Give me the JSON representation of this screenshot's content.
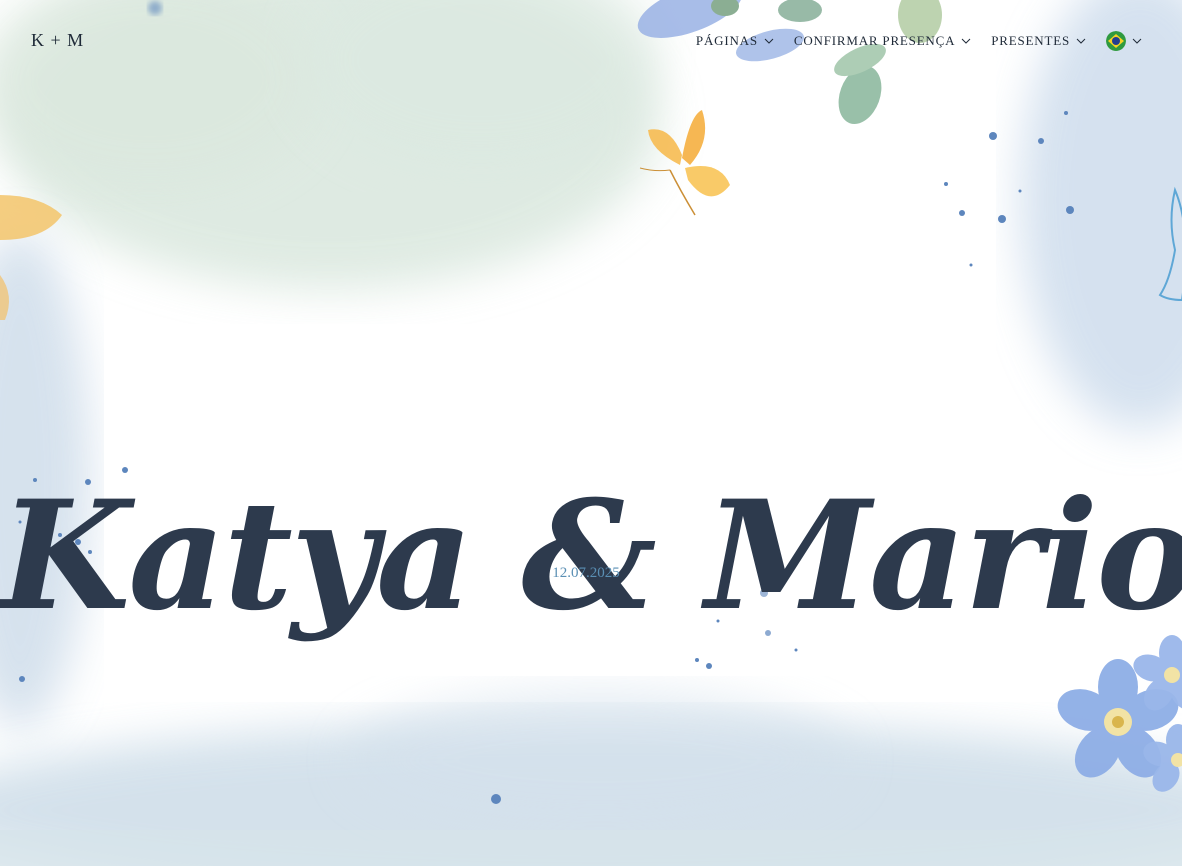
{
  "header": {
    "logo": "K + M",
    "nav": [
      {
        "label": "PÁGINAS",
        "icon": "chevron-down-icon"
      },
      {
        "label": "CONFIRMAR PRESENÇA",
        "icon": "chevron-down-icon"
      },
      {
        "label": "PRESENTES",
        "icon": "chevron-down-icon"
      }
    ],
    "language": {
      "icon": "brazil-flag-icon"
    }
  },
  "hero": {
    "names": "Katya & Mario",
    "date": "12.07.2025"
  },
  "colors": {
    "title": "#2d3a4d",
    "date": "#5a8fb4",
    "watercolor_blue": "#9fb8d8",
    "watercolor_green": "#cfe0d6",
    "butterfly": "#f5b84b",
    "flower": "#8aa8e0"
  }
}
